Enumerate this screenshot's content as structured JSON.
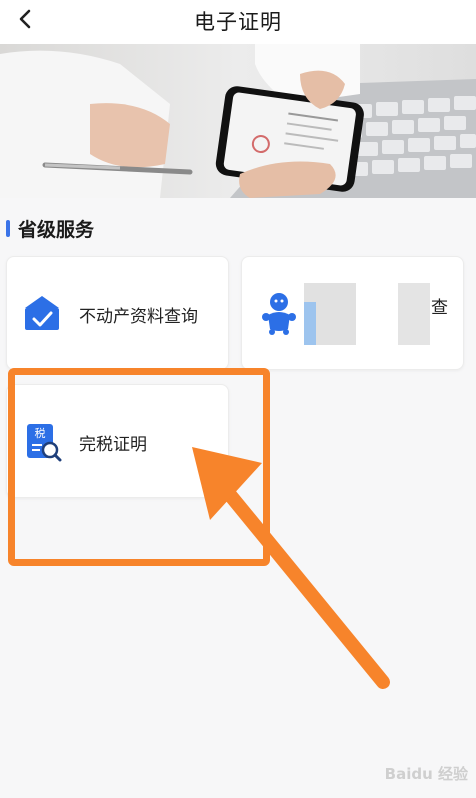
{
  "header": {
    "title": "电子证明"
  },
  "section": {
    "title": "省级服务"
  },
  "services": [
    {
      "label": "不动产资料查询"
    },
    {
      "label": "查"
    },
    {
      "label": "完税证明"
    }
  ],
  "watermark": {
    "text": "Baidu 经验"
  },
  "colors": {
    "accent": "#3b74e8",
    "highlight": "#f7842b",
    "icon_blue": "#2c6fe6"
  }
}
